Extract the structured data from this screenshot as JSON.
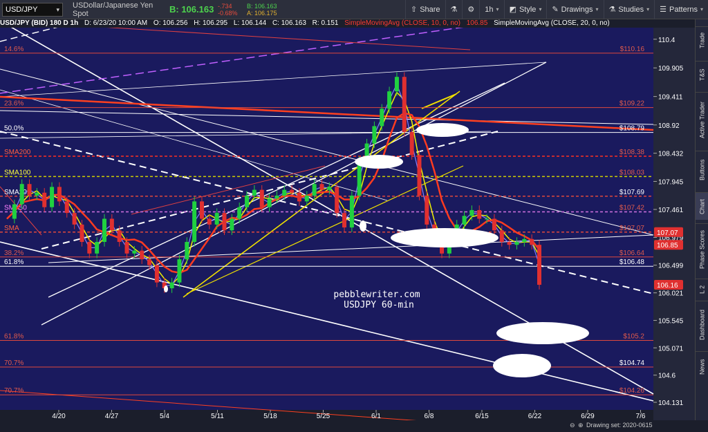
{
  "toolbar": {
    "symbol": "USD/JPY",
    "description": "USDollar/Japanese Yen Spot",
    "last_label": "B: 106.163",
    "change": "-.734",
    "change_pct": "-0.68%",
    "bid_label": "B: 106.163",
    "ask_label": "A: 106.175",
    "share_label": "Share",
    "interval_label": "1h",
    "style_label": "Style",
    "drawings_label": "Drawings",
    "studies_label": "Studies",
    "patterns_label": "Patterns"
  },
  "infobar": {
    "symbol_info": "USD/JPY (BID) 180 D 1h",
    "date": "D: 6/23/20 10:00 AM",
    "open": "O: 106.256",
    "high": "H: 106.295",
    "low": "L: 106.144",
    "close": "C: 106.163",
    "range": "R: 0.151",
    "sma10": "SimpleMovingAvg (CLOSE, 10, 0, no)",
    "sma10_value": "106.85",
    "sma20": "SimpleMovingAvg (CLOSE, 20, 0, no)"
  },
  "sidebar_tabs": [
    "Trade",
    "T&S",
    "Active Trader",
    "Buttons",
    "Chart",
    "Phase Scores",
    "L 2",
    "Dashboard",
    "News"
  ],
  "status": {
    "drawing_set": "Drawing set: 2020-0615"
  },
  "colors": {
    "plot_bg": "#1a1a5e",
    "fib_line": "#e0483c",
    "sma200": "#ff3b30",
    "sma100": "#ffff00",
    "sma20": "#ff5a3c",
    "sma50": "#e080ff",
    "sma_yellow": "#f0f000",
    "price_up": "#20d040",
    "price_down": "#e03030"
  },
  "chart_data": {
    "type": "line",
    "title": "",
    "watermark_line1": "pebblewriter.com",
    "watermark_line2": "USDJPY 60-min",
    "x_tick_labels": [
      "4/20",
      "4/27",
      "5/4",
      "5/11",
      "5/18",
      "5/25",
      "6/1",
      "6/8",
      "6/15",
      "6/22",
      "6/29",
      "7/6"
    ],
    "y_tick_labels": [
      "110.4",
      "109.905",
      "109.411",
      "108.92",
      "108.432",
      "107.945",
      "107.461",
      "106.979",
      "106.499",
      "106.021",
      "105.545",
      "105.071",
      "104.6",
      "104.131"
    ],
    "ylim": [
      104.0,
      110.6
    ],
    "fib_levels": [
      {
        "label": "14.6%",
        "value": 110.16,
        "price_label": "$110.16"
      },
      {
        "label": "23.6%",
        "value": 109.22,
        "price_label": "$109.22"
      },
      {
        "label": "50.0%",
        "value": 108.79,
        "price_label": "$108.79"
      },
      {
        "label": "SMA200",
        "value": 108.38,
        "price_label": "$108.38"
      },
      {
        "label": "SMA100",
        "value": 108.03,
        "price_label": "$108.03"
      },
      {
        "label": "SMA20",
        "value": 107.69,
        "price_label": "$107.69"
      },
      {
        "label": "SMA50",
        "value": 107.42,
        "price_label": "$107.42"
      },
      {
        "label": "SMA",
        "value": 107.07,
        "price_label": "$107.07"
      },
      {
        "label": "38.2%",
        "value": 106.64,
        "price_label": "$106.64"
      },
      {
        "label": "61.8%",
        "value": 106.48,
        "price_label": "$106.48"
      },
      {
        "label": "61.8%",
        "value": 105.2,
        "price_label": "$105.2"
      },
      {
        "label": "70.7%",
        "value": 104.74,
        "price_label": "$104.74"
      },
      {
        "label": "70.7%",
        "value": 104.26,
        "price_label": "$104.26"
      }
    ],
    "price_badges": [
      {
        "text": "107.07",
        "value": 107.07,
        "color": "#e03030"
      },
      {
        "text": "106.85",
        "value": 106.85,
        "color": "#e03030"
      },
      {
        "text": "106.16",
        "value": 106.16,
        "color": "#e03030"
      }
    ],
    "series": [
      {
        "name": "",
        "values": [
          107.3,
          107.55,
          107.9,
          107.7,
          107.75,
          107.5,
          107.85,
          107.6,
          107.4,
          107.2,
          106.9,
          106.7,
          106.9,
          107.3,
          107.1,
          106.9,
          106.7,
          106.75,
          106.6,
          106.5,
          106.2,
          106.1,
          106.2,
          106.6,
          106.9,
          107.6,
          107.3,
          107.2,
          107.4,
          107.1,
          107.3,
          107.5,
          107.7,
          107.8,
          107.5,
          107.65,
          107.7,
          107.8,
          107.75,
          107.6,
          107.7,
          107.9,
          107.8,
          107.85,
          107.4,
          107.15,
          107.7,
          108.3,
          108.6,
          108.9,
          109.2,
          109.5,
          109.75,
          108.8,
          108.4,
          107.7,
          107.2,
          106.9,
          106.7,
          106.95,
          107.2,
          107.35,
          107.45,
          107.3,
          107.3,
          107.1,
          106.9,
          106.85,
          106.9,
          106.95,
          106.85,
          106.16
        ]
      }
    ]
  }
}
